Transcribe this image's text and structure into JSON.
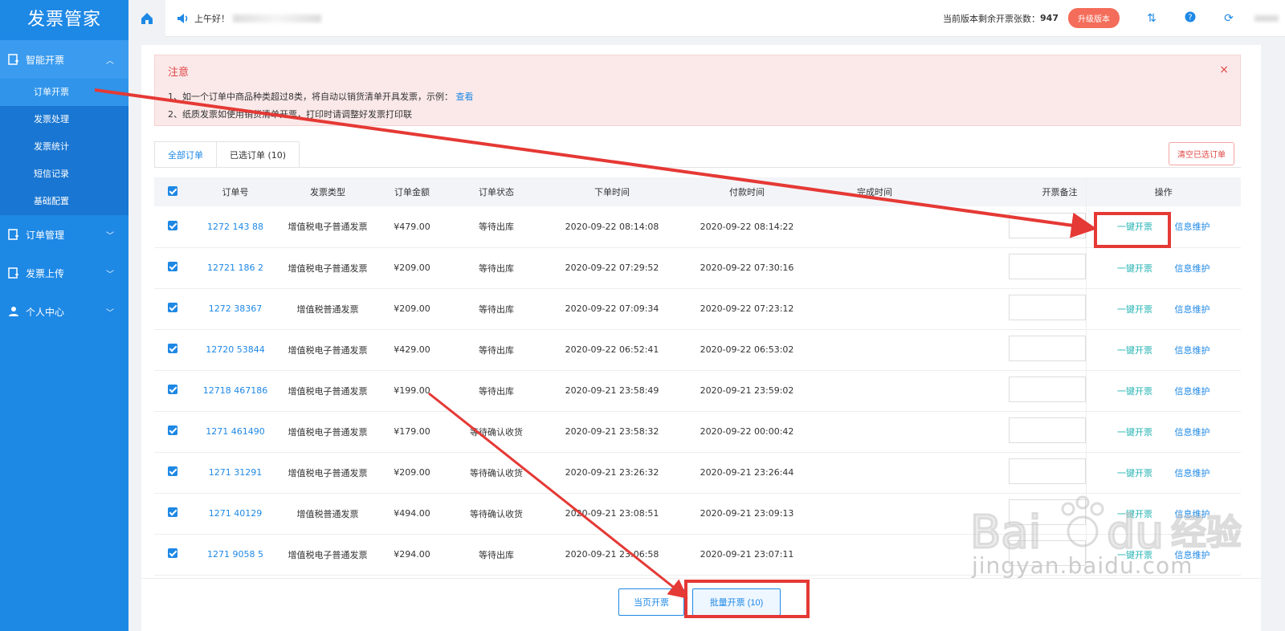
{
  "app": {
    "title": "发票管家"
  },
  "sidebar": {
    "groups": [
      {
        "label": "智能开票",
        "expanded": true,
        "items": [
          "订单开票",
          "发票处理",
          "发票统计",
          "短信记录",
          "基础配置"
        ]
      },
      {
        "label": "订单管理"
      },
      {
        "label": "发票上传"
      },
      {
        "label": "个人中心"
      }
    ]
  },
  "topbar": {
    "greeting": "上午好！",
    "remaining_label": "当前版本剩余开票张数：",
    "remaining_count": "947",
    "upgrade_label": "升级版本"
  },
  "notice": {
    "title": "注意",
    "line1": "1、如一个订单中商品种类超过8类，将自动以销货清单开具发票，示例：",
    "line1_link": "查看",
    "line2": "2、纸质发票如使用销货清单开票，打印时请调整好发票打印联"
  },
  "tabs": {
    "all": "全部订单",
    "selected": "已选订单 (10)",
    "clear": "清空已选订单"
  },
  "table": {
    "headers": [
      "订单号",
      "发票类型",
      "订单金额",
      "订单状态",
      "下单时间",
      "付款时间",
      "完成时间",
      "开票备注",
      "操作"
    ],
    "actions": {
      "invoice": "一键开票",
      "maintain": "信息维护"
    },
    "rows": [
      {
        "order": "1272 143 88",
        "type": "增值税电子普通发票",
        "amount": "¥479.00",
        "status": "等待出库",
        "ordered": "2020-09-22 08:14:08",
        "paid": "2020-09-22 08:14:22"
      },
      {
        "order": "12721 186 2",
        "type": "增值税电子普通发票",
        "amount": "¥209.00",
        "status": "等待出库",
        "ordered": "2020-09-22 07:29:52",
        "paid": "2020-09-22 07:30:16"
      },
      {
        "order": "1272 38367",
        "type": "增值税普通发票",
        "amount": "¥209.00",
        "status": "等待出库",
        "ordered": "2020-09-22 07:09:34",
        "paid": "2020-09-22 07:23:12"
      },
      {
        "order": "12720 53844",
        "type": "增值税电子普通发票",
        "amount": "¥429.00",
        "status": "等待出库",
        "ordered": "2020-09-22 06:52:41",
        "paid": "2020-09-22 06:53:02"
      },
      {
        "order": "12718 467186",
        "type": "增值税电子普通发票",
        "amount": "¥199.00",
        "status": "等待出库",
        "ordered": "2020-09-21 23:58:49",
        "paid": "2020-09-21 23:59:02"
      },
      {
        "order": "1271 461490",
        "type": "增值税电子普通发票",
        "amount": "¥179.00",
        "status": "等待确认收货",
        "ordered": "2020-09-21 23:58:32",
        "paid": "2020-09-22 00:00:42"
      },
      {
        "order": "1271 31291",
        "type": "增值税电子普通发票",
        "amount": "¥209.00",
        "status": "等待确认收货",
        "ordered": "2020-09-21 23:26:32",
        "paid": "2020-09-21 23:26:44"
      },
      {
        "order": "1271 40129",
        "type": "增值税普通发票",
        "amount": "¥494.00",
        "status": "等待确认收货",
        "ordered": "2020-09-21 23:08:51",
        "paid": "2020-09-21 23:09:13"
      },
      {
        "order": "1271 9058 5",
        "type": "增值税电子普通发票",
        "amount": "¥294.00",
        "status": "等待出库",
        "ordered": "2020-09-21 23:06:58",
        "paid": "2020-09-21 23:07:11"
      }
    ]
  },
  "bottom": {
    "page_btn": "当页开票",
    "batch_btn": "批量开票 (10)"
  },
  "watermark": {
    "text": "jingyan.baidu.com"
  }
}
